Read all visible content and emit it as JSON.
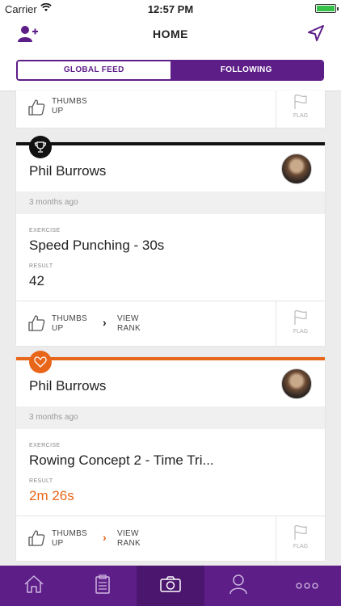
{
  "status": {
    "carrier": "Carrier",
    "time": "12:57 PM"
  },
  "nav": {
    "title": "HOME",
    "left_icon": "add-user-icon",
    "right_icon": "location-arrow-icon"
  },
  "segments": {
    "global": "GLOBAL FEED",
    "following": "FOLLOWING",
    "active": "following"
  },
  "partial_card": {
    "thumbs_line1": "THUMBS",
    "thumbs_line2": "UP",
    "flag": "FLAG"
  },
  "cards": [
    {
      "accent": "#111111",
      "badge_icon": "trophy-icon",
      "name": "Phil Burrows",
      "time_ago": "3 months ago",
      "exercise_label": "EXERCISE",
      "exercise": "Speed Punching - 30s",
      "result_label": "RESULT",
      "result": "42",
      "result_color": "#222222",
      "thumbs_line1": "THUMBS",
      "thumbs_line2": "UP",
      "view_line1": "VIEW",
      "view_line2": "RANK",
      "flag": "FLAG"
    },
    {
      "accent": "#e8661a",
      "badge_icon": "heart-icon",
      "name": "Phil Burrows",
      "time_ago": "3 months ago",
      "exercise_label": "EXERCISE",
      "exercise": "Rowing Concept 2 - Time Tri...",
      "result_label": "RESULT",
      "result": "2m 26s",
      "result_color": "#e8661a",
      "thumbs_line1": "THUMBS",
      "thumbs_line2": "UP",
      "view_line1": "VIEW",
      "view_line2": "RANK",
      "flag": "FLAG"
    }
  ],
  "tabbar": {
    "tabs": [
      "home-icon",
      "clipboard-icon",
      "camera-icon",
      "profile-icon",
      "more-icon"
    ],
    "selected": "camera-icon",
    "color": "#5e1e88"
  }
}
